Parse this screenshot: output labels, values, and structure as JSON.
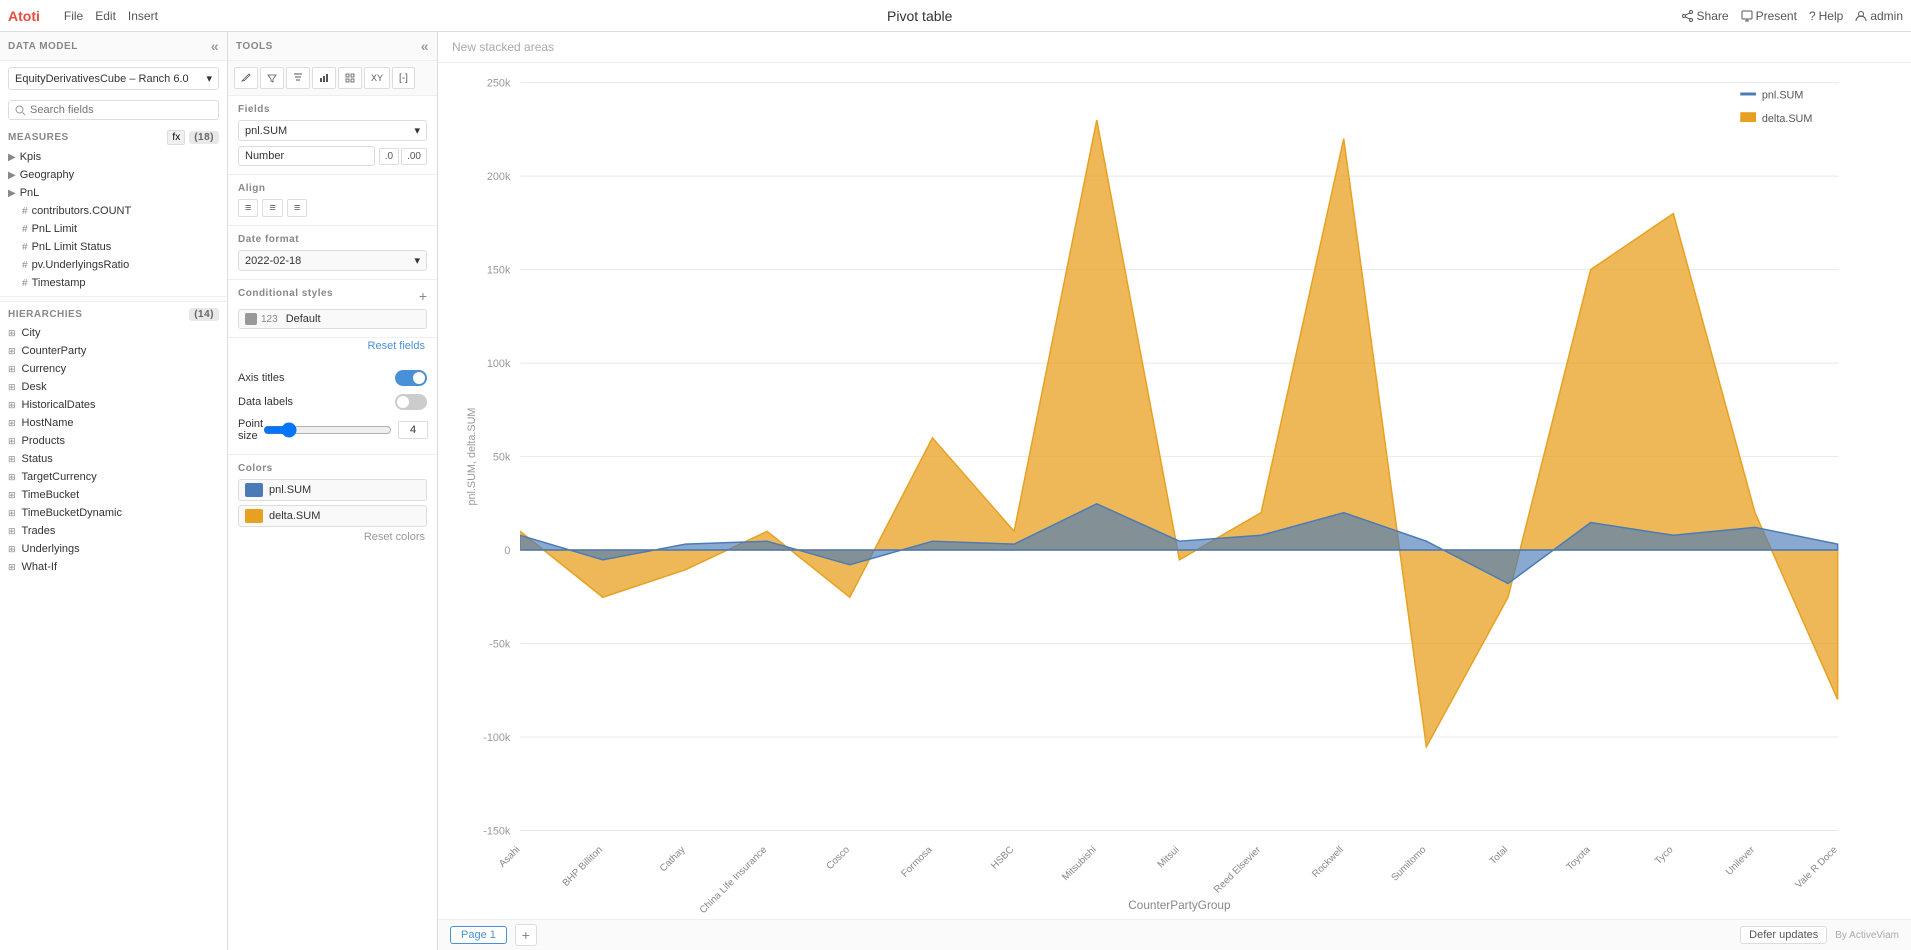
{
  "app": {
    "logo": "Atoti",
    "menu": [
      "File",
      "Edit",
      "Insert"
    ],
    "title": "Pivot table",
    "actions": {
      "share": "Share",
      "present": "Present",
      "help": "Help",
      "user": "admin"
    }
  },
  "left_panel": {
    "header": "DATA MODEL",
    "model_select": "EquityDerivativesCube – Ranch 6.0",
    "search_placeholder": "Search fields",
    "measures_header": "MEASURES",
    "measures_count": "(18)",
    "fx_label": "fx",
    "measures": [
      {
        "label": "Kpis",
        "type": "folder"
      },
      {
        "label": "Geography",
        "type": "folder"
      },
      {
        "label": "PnL",
        "type": "folder"
      },
      {
        "label": "contributors.COUNT",
        "type": "hash"
      },
      {
        "label": "PnL Limit",
        "type": "hash"
      },
      {
        "label": "PnL Limit Status",
        "type": "hash"
      },
      {
        "label": "pv.UnderlyingsRatio",
        "type": "hash"
      },
      {
        "label": "Timestamp",
        "type": "hash"
      }
    ],
    "hierarchies_header": "HIERARCHIES",
    "hierarchies_count": "(14)",
    "hierarchies": [
      "City",
      "CounterParty",
      "Currency",
      "Desk",
      "HistoricalDates",
      "HostName",
      "Products",
      "Status",
      "TargetCurrency",
      "TimeBucket",
      "TimeBucketDynamic",
      "Trades",
      "Underlyings",
      "What-If"
    ]
  },
  "tools_panel": {
    "header": "TOOLS",
    "toolbar_icons": [
      "pencil",
      "filter",
      "funnel",
      "bar-chart",
      "grid",
      "xy",
      "bracket"
    ],
    "fields_label": "Fields",
    "field_value": "pnl.SUM",
    "type_value": "Number",
    "align_label": "Align",
    "date_format_label": "Date format",
    "date_format_value": "2022-02-18",
    "conditional_styles_label": "Conditional styles",
    "cond_default_label": "Default",
    "reset_fields_label": "Reset fields",
    "axis_titles_label": "Axis titles",
    "axis_titles_on": true,
    "data_labels_label": "Data labels",
    "data_labels_on": false,
    "point_size_label": "Point size",
    "point_size_value": "4",
    "colors_label": "Colors",
    "colors": [
      {
        "label": "pnl.SUM",
        "color": "#4a7bb7"
      },
      {
        "label": "delta.SUM",
        "color": "#e8a020"
      }
    ],
    "reset_colors_label": "Reset colors"
  },
  "chart": {
    "new_chart_label": "New stacked areas",
    "y_axis_label": "pnl.SUM, delta.SUM",
    "x_axis_label": "CounterPartyGroup",
    "x_labels": [
      "Asahi",
      "BHP Billiton",
      "Cathay",
      "China Life Insurance",
      "Cosco",
      "Formosa",
      "HSBC",
      "Mitsubishi",
      "Mitsui",
      "Reed Elsevier",
      "Rockwell",
      "Sumitomo",
      "Total",
      "Toyota",
      "Tyco",
      "Unilever",
      "Vale R Doce"
    ],
    "y_ticks": [
      "250k",
      "200k",
      "150k",
      "100k",
      "50k",
      "0",
      "-50k",
      "-100k",
      "-150k"
    ],
    "legend": [
      {
        "label": "pnl.SUM",
        "color": "#4a7bb7"
      },
      {
        "label": "delta.SUM",
        "color": "#e8a020"
      }
    ]
  },
  "footer": {
    "page_label": "Page 1",
    "defer_label": "Defer updates",
    "brand_label": "By ActiveViam"
  }
}
